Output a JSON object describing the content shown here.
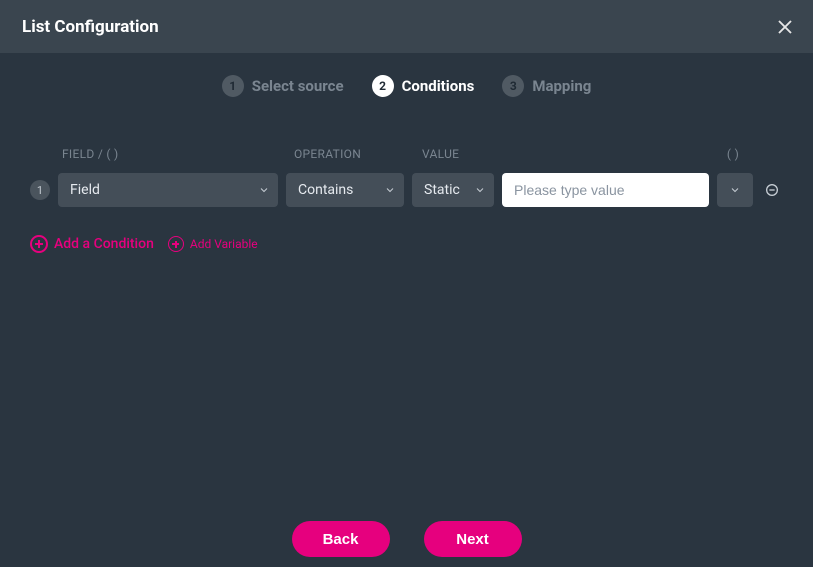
{
  "header": {
    "title": "List Configuration"
  },
  "stepper": {
    "steps": [
      {
        "num": "1",
        "label": "Select source",
        "active": false
      },
      {
        "num": "2",
        "label": "Conditions",
        "active": true
      },
      {
        "num": "3",
        "label": "Mapping",
        "active": false
      }
    ]
  },
  "columns": {
    "field": "FIELD / ( )",
    "operation": "OPERATION",
    "value": "VALUE",
    "paren": "( )"
  },
  "condition_row": {
    "index": "1",
    "field_select": "Field",
    "operation_select": "Contains",
    "value_type_select": "Static",
    "value_input": "",
    "value_placeholder": "Please type value"
  },
  "add_links": {
    "add_condition": "Add a Condition",
    "add_variable": "Add Variable"
  },
  "footer": {
    "back": "Back",
    "next": "Next"
  }
}
